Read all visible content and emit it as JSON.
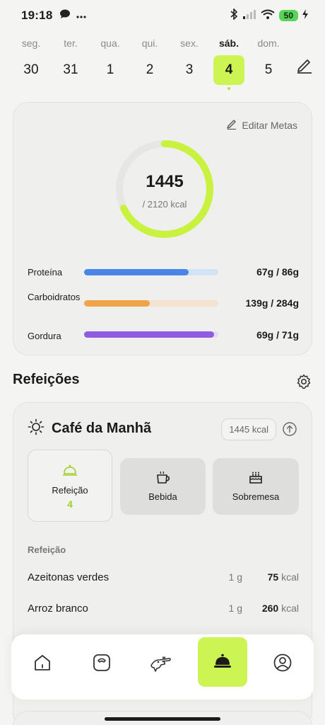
{
  "status_bar": {
    "time": "19:18",
    "battery": "50"
  },
  "week": {
    "days": [
      {
        "name": "seg.",
        "num": "30"
      },
      {
        "name": "ter.",
        "num": "31"
      },
      {
        "name": "qua.",
        "num": "1"
      },
      {
        "name": "qui.",
        "num": "2"
      },
      {
        "name": "sex.",
        "num": "3"
      },
      {
        "name": "sáb.",
        "num": "4"
      },
      {
        "name": "dom.",
        "num": "5"
      }
    ]
  },
  "summary": {
    "edit_goals": "Editar Metas",
    "calories": "1445",
    "calories_goal": "/ 2120 kcal",
    "calories_progress": 0.68,
    "macros": [
      {
        "label": "Proteína",
        "value": "67g / 86g",
        "progress": 0.78,
        "color": "#4a86e8",
        "track": "#d4e2f6"
      },
      {
        "label": "Carboidratos",
        "value": "139g / 284g",
        "progress": 0.49,
        "color": "#f0a44a",
        "track": "#f4e4cf"
      },
      {
        "label": "Gordura",
        "value": "69g / 71g",
        "progress": 0.97,
        "color": "#8d5ce0",
        "track": "#e4dcf3"
      }
    ]
  },
  "meals": {
    "title": "Refeições",
    "card": {
      "title": "Café da Manhã",
      "kcal": "1445 kcal",
      "tiles": [
        {
          "label": "Refeição",
          "count": "4"
        },
        {
          "label": "Bebida"
        },
        {
          "label": "Sobremesa"
        }
      ],
      "section_label": "Refeição",
      "foods": [
        {
          "name": "Azeitonas verdes",
          "qty": "1 g",
          "kcal": "75",
          "unit": "kcal"
        },
        {
          "name": "Arroz branco",
          "qty": "1 g",
          "kcal": "260",
          "unit": "kcal"
        }
      ]
    }
  },
  "colors": {
    "accent": "#ccf553",
    "ring": "#c9f23f",
    "ring_track": "#e6e6e4"
  }
}
